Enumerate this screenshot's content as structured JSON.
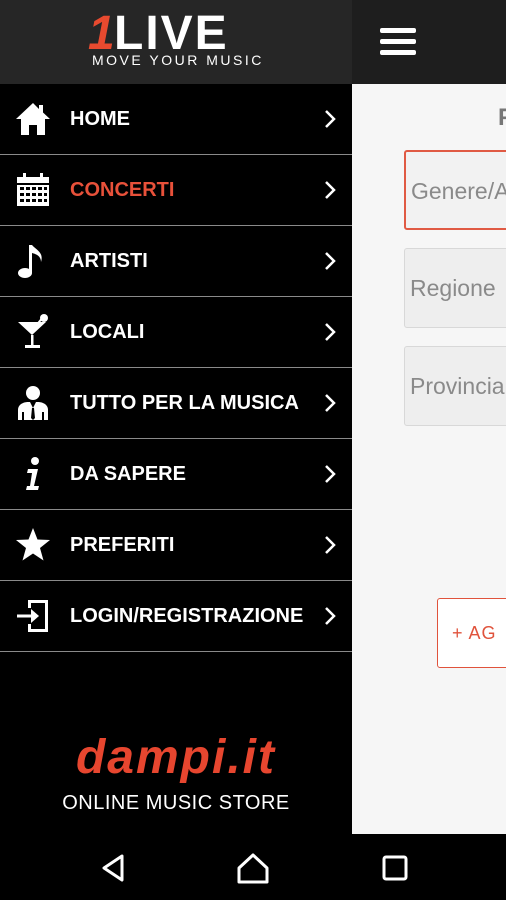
{
  "app": {
    "logo_number": "1",
    "logo_text": "LIVE",
    "logo_tagline": "MOVE YOUR MUSIC"
  },
  "main": {
    "heading_partial": "P",
    "fields": [
      {
        "placeholder": "Genere/A"
      },
      {
        "placeholder": "Regione"
      },
      {
        "placeholder": "Provincia"
      }
    ],
    "add_button_label": "+  AG"
  },
  "menu": {
    "items": [
      {
        "label": "HOME",
        "icon": "home-icon",
        "active": false
      },
      {
        "label": "CONCERTI",
        "icon": "calendar-icon",
        "active": true
      },
      {
        "label": "ARTISTI",
        "icon": "music-note-icon",
        "active": false
      },
      {
        "label": "LOCALI",
        "icon": "cocktail-icon",
        "active": false
      },
      {
        "label": "TUTTO PER LA MUSICA",
        "icon": "person-suit-icon",
        "active": false
      },
      {
        "label": "DA SAPERE",
        "icon": "info-icon",
        "active": false
      },
      {
        "label": "PREFERITI",
        "icon": "star-icon",
        "active": false
      },
      {
        "label": "LOGIN/REGISTRAZIONE",
        "icon": "login-icon",
        "active": false
      }
    ]
  },
  "brand": {
    "name": "dampi.it",
    "subtitle": "ONLINE MUSIC STORE"
  },
  "colors": {
    "accent": "#e8513a",
    "drawer_bg": "#000000",
    "header_bg": "#262626",
    "divider": "#8a8a8a"
  }
}
